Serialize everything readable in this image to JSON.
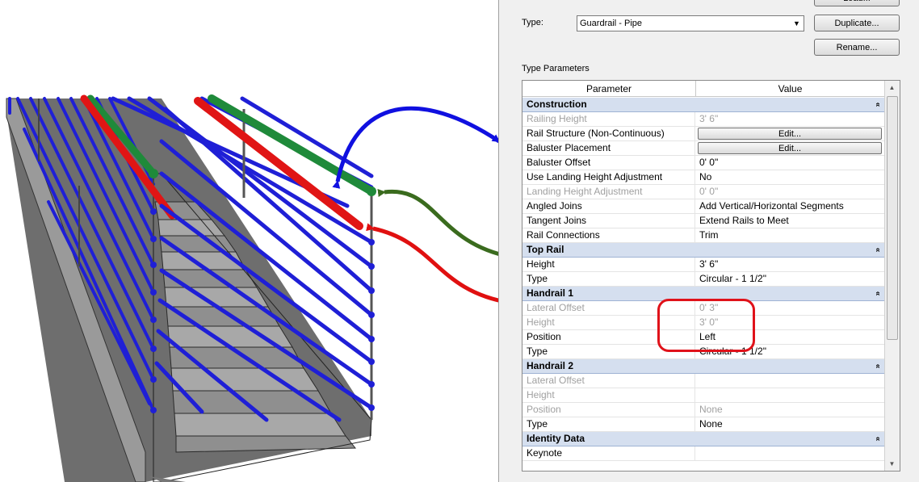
{
  "dialog": {
    "type_label": "Type:",
    "type_value": "Guardrail - Pipe",
    "buttons": {
      "load": "Load...",
      "duplicate": "Duplicate...",
      "rename": "Rename..."
    },
    "type_parameters_label": "Type Parameters",
    "columns": {
      "parameter": "Parameter",
      "value": "Value"
    },
    "groups": [
      {
        "name": "Construction",
        "rows": [
          {
            "param": "Railing Height",
            "value": "3'  6\"",
            "dim": true
          },
          {
            "param": "Rail Structure (Non-Continuous)",
            "value": "Edit...",
            "button": true
          },
          {
            "param": "Baluster Placement",
            "value": "Edit...",
            "button": true
          },
          {
            "param": "Baluster Offset",
            "value": "0'  0\""
          },
          {
            "param": "Use Landing Height Adjustment",
            "value": "No"
          },
          {
            "param": "Landing Height Adjustment",
            "value": "0'  0\"",
            "dim": true
          },
          {
            "param": "Angled Joins",
            "value": "Add Vertical/Horizontal Segments"
          },
          {
            "param": "Tangent Joins",
            "value": "Extend Rails to Meet"
          },
          {
            "param": "Rail Connections",
            "value": "Trim"
          }
        ]
      },
      {
        "name": "Top Rail",
        "rows": [
          {
            "param": "Height",
            "value": "3'  6\""
          },
          {
            "param": "Type",
            "value": "Circular - 1 1/2\""
          }
        ]
      },
      {
        "name": "Handrail 1",
        "rows": [
          {
            "param": "Lateral Offset",
            "value": "0'  3\"",
            "dim": true
          },
          {
            "param": "Height",
            "value": "3'  0\"",
            "dim": true
          },
          {
            "param": "Position",
            "value": "Left"
          },
          {
            "param": "Type",
            "value": "Circular - 1 1/2\""
          }
        ]
      },
      {
        "name": "Handrail 2",
        "rows": [
          {
            "param": "Lateral Offset",
            "value": "",
            "dim": true
          },
          {
            "param": "Height",
            "value": "",
            "dim": true
          },
          {
            "param": "Position",
            "value": "None",
            "dim": true
          },
          {
            "param": "Type",
            "value": "None"
          }
        ]
      },
      {
        "name": "Identity Data",
        "rows": [
          {
            "param": "Keynote",
            "value": ""
          }
        ]
      }
    ],
    "collapse_glyph": "«"
  },
  "colors": {
    "blue_rail": "#1f1fd6",
    "green_rail": "#1f8a3a",
    "red_rail": "#e01515",
    "arrow_blue": "#1010e0",
    "arrow_green": "#3a6b1e",
    "arrow_red": "#e01010",
    "group_header": "#d5dfef",
    "highlight": "#e0121a"
  }
}
